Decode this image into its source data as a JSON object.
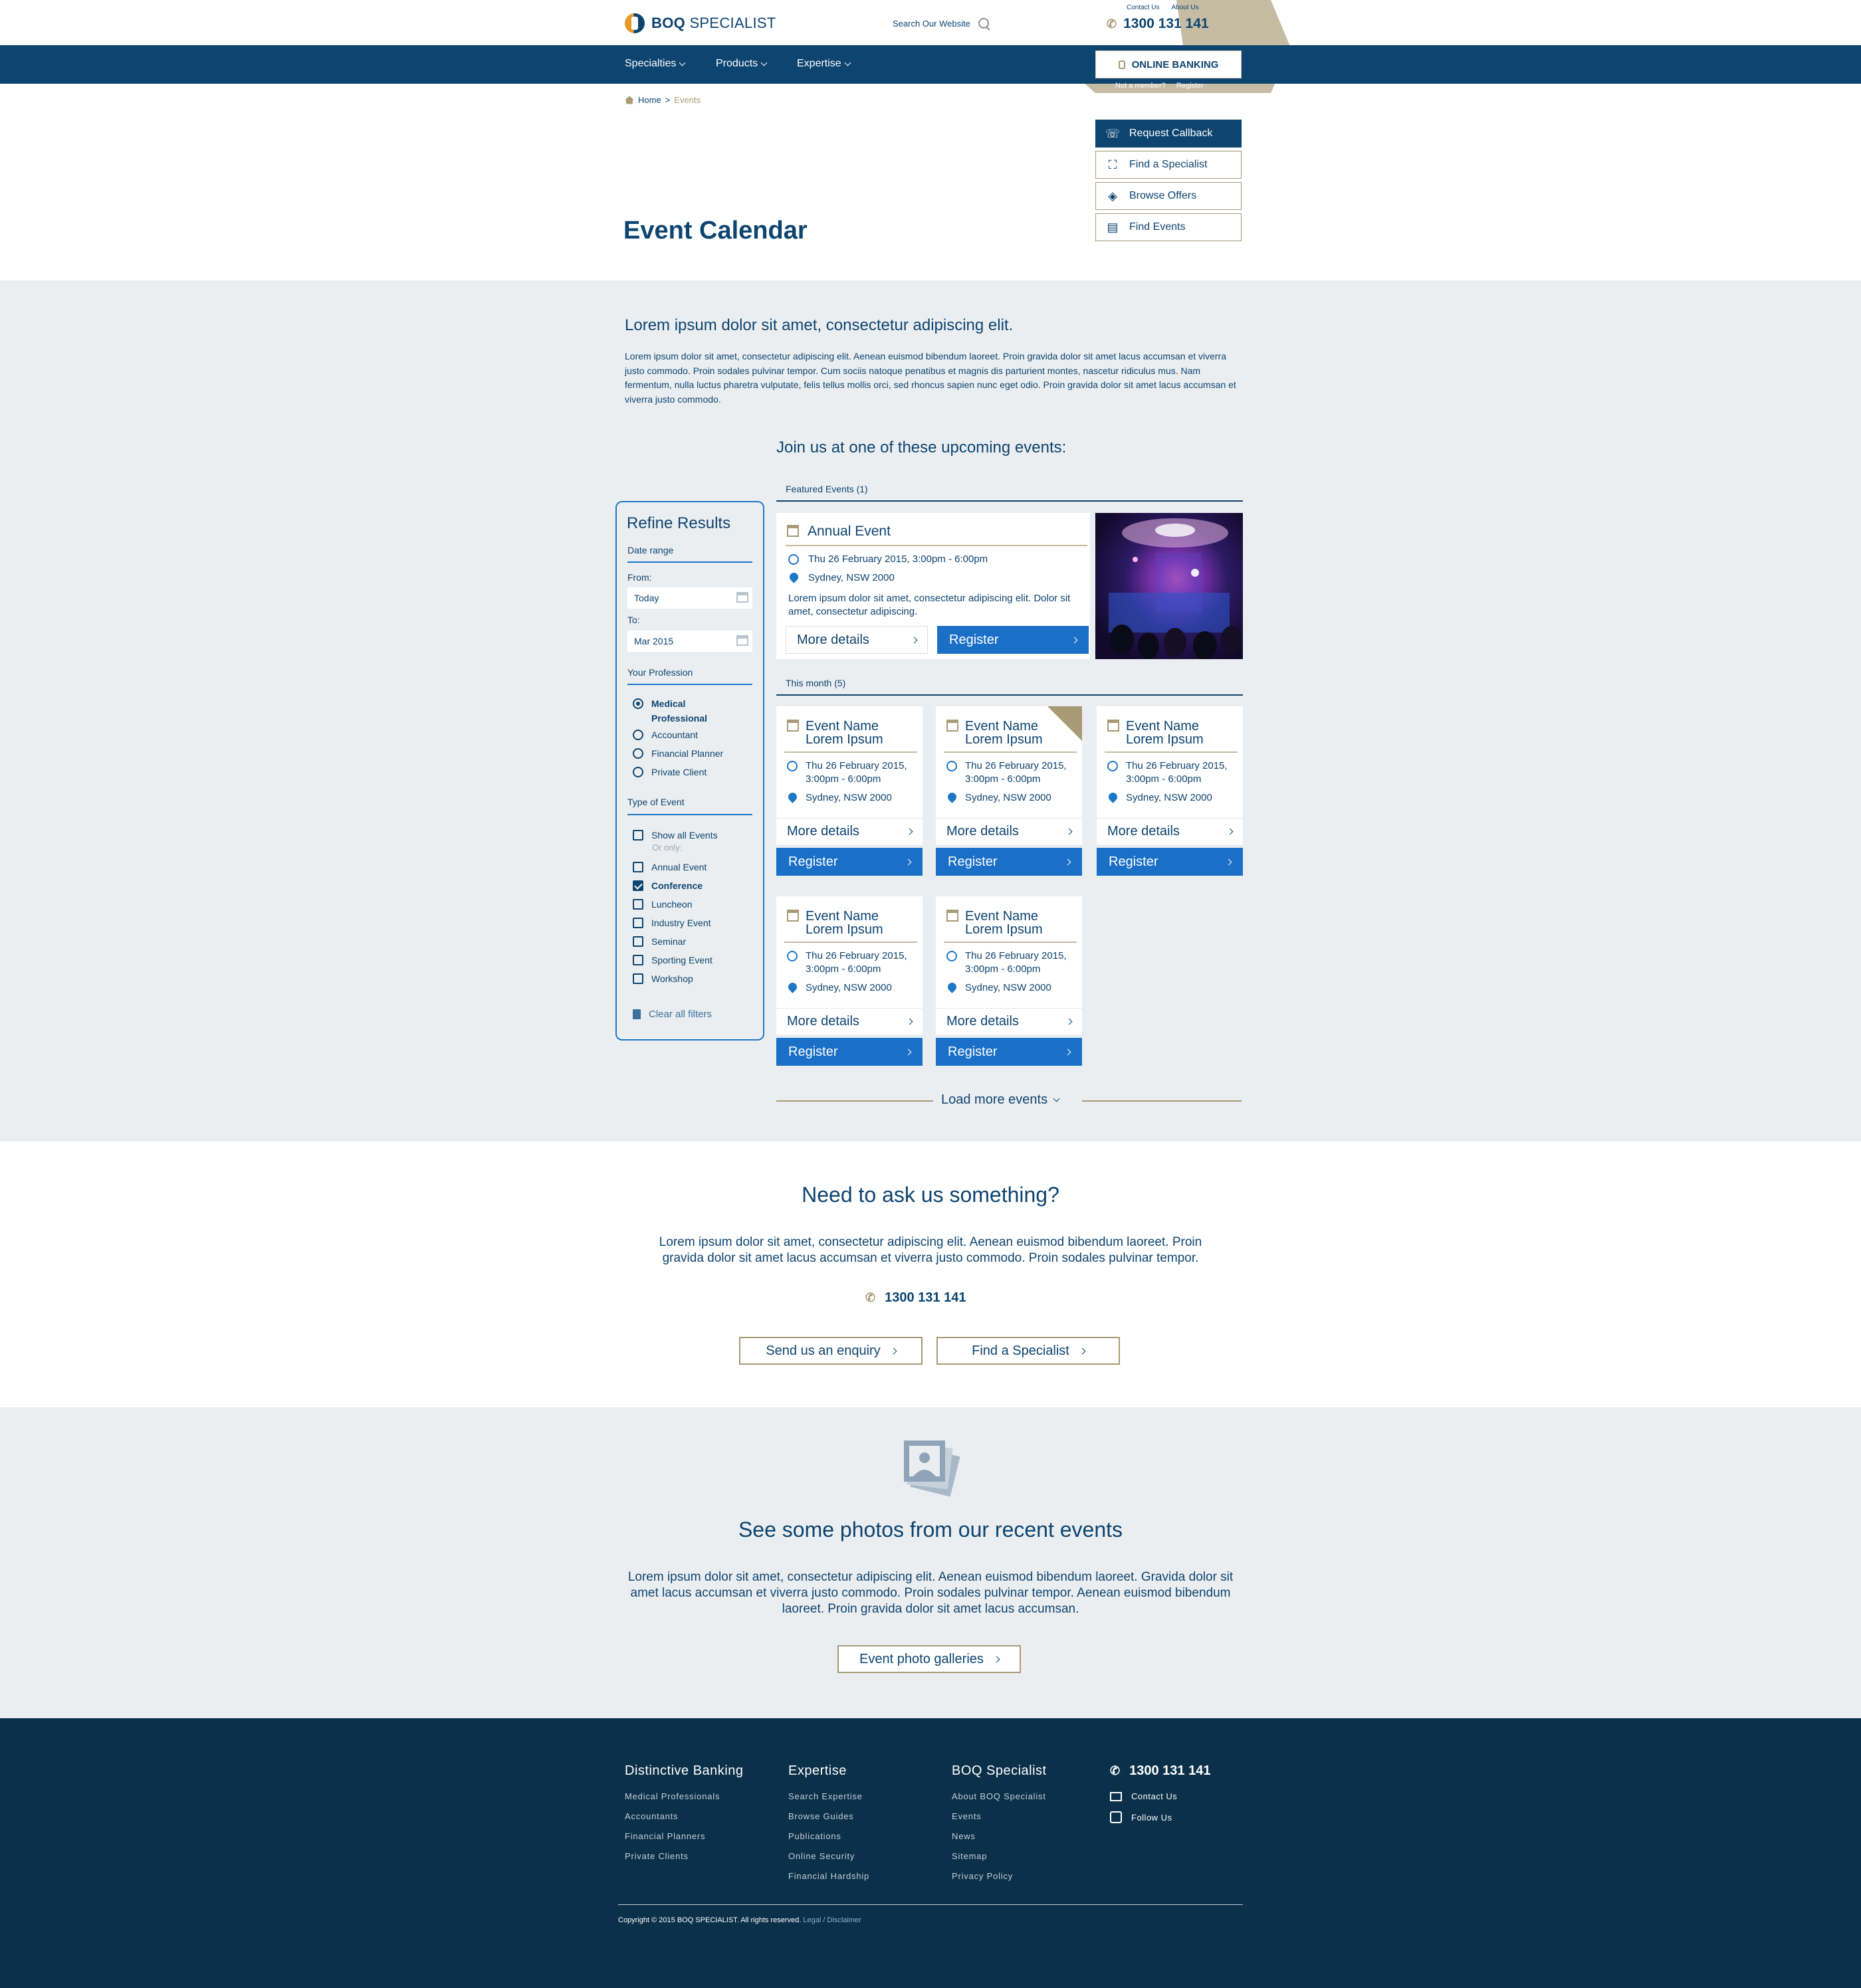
{
  "header": {
    "logo": {
      "bold": "BOQ",
      "rest": "SPECIALIST"
    },
    "search_label": "Search Our Website",
    "top_links": [
      "Contact Us",
      "About Us"
    ],
    "phone": "1300 131 141",
    "online_banking": "ONLINE BANKING",
    "not_member": "Not a member?",
    "register": "Register"
  },
  "nav": {
    "items": [
      "Specialties",
      "Products",
      "Expertise"
    ]
  },
  "breadcrumb": {
    "home": "Home",
    "sep": ">",
    "current": "Events"
  },
  "quick_links": [
    "Request Callback",
    "Find a Specialist",
    "Browse Offers",
    "Find Events"
  ],
  "page_title": "Event Calendar",
  "intro": {
    "heading": "Lorem ipsum dolor sit amet, consectetur adipiscing elit.",
    "body": "Lorem ipsum dolor sit amet, consectetur adipiscing elit. Aenean euismod bibendum laoreet. Proin gravida dolor sit amet lacus accumsan et viverra justo commodo. Proin sodales pulvinar tempor. Cum sociis natoque penatibus et magnis dis parturient montes, nascetur ridiculus mus. Nam fermentum, nulla luctus pharetra vulputate, felis tellus mollis orci, sed rhoncus sapien nunc eget odio. Proin gravida dolor sit amet lacus accumsan et viverra justo commodo."
  },
  "join_heading": "Join us at one of these upcoming events:",
  "refine": {
    "title": "Refine Results",
    "date_range": "Date range",
    "from_label": "From:",
    "from_value": "Today",
    "to_label": "To:",
    "to_value": "Mar 2015",
    "profession_label": "Your Profession",
    "professions": [
      "Medical Professional",
      "Accountant",
      "Financial Planner",
      "Private Client"
    ],
    "selected_profession": "Medical Professional",
    "type_label": "Type of Event",
    "show_all": "Show all Events",
    "or_only": "Or only:",
    "types": [
      "Annual Event",
      "Conference",
      "Luncheon",
      "Industry Event",
      "Seminar",
      "Sporting Event",
      "Workshop"
    ],
    "checked_types": [
      "Conference"
    ],
    "clear": "Clear all filters"
  },
  "featured": {
    "heading": "Featured Events (1)",
    "title": "Annual Event",
    "date": "Thu 26 February 2015, 3:00pm - 6:00pm",
    "location": "Sydney, NSW 2000",
    "desc": "Lorem ipsum dolor sit amet, consectetur adipiscing elit. Dolor sit amet, consectetur adipiscing.",
    "more": "More details",
    "register": "Register"
  },
  "month": {
    "heading": "This month (5)",
    "card": {
      "title_1": "Event Name",
      "title_2": "Lorem Ipsum",
      "date_1": "Thu 26 February 2015,",
      "date_2": "3:00pm - 6:00pm",
      "location": "Sydney, NSW 2000",
      "more": "More details",
      "register": "Register"
    }
  },
  "load_more": "Load more events",
  "ask": {
    "heading": "Need to ask us something?",
    "body": "Lorem ipsum dolor sit amet, consectetur adipiscing elit. Aenean euismod bibendum laoreet. Proin gravida dolor sit amet lacus accumsan et viverra justo commodo. Proin sodales pulvinar tempor.",
    "phone": "1300 131 141",
    "enquiry": "Send us an enquiry",
    "find": "Find a Specialist"
  },
  "photos": {
    "heading": "See some photos from our recent events",
    "body": "Lorem ipsum dolor sit amet, consectetur adipiscing elit. Aenean euismod bibendum laoreet. Gravida dolor sit amet lacus accumsan et viverra justo commodo. Proin sodales pulvinar tempor. Aenean euismod bibendum laoreet. Proin gravida dolor sit amet lacus accumsan.",
    "button": "Event photo galleries"
  },
  "footer": {
    "col1": {
      "title": "Distinctive Banking",
      "links": [
        "Medical Professionals",
        "Accountants",
        "Financial Planners",
        "Private Clients"
      ]
    },
    "col2": {
      "title": "Expertise",
      "links": [
        "Search Expertise",
        "Browse Guides",
        "Publications",
        "Online Security",
        "Financial Hardship"
      ]
    },
    "col3": {
      "title": "BOQ Specialist",
      "links": [
        "About BOQ Specialist",
        "Events",
        "News",
        "Sitemap",
        "Privacy Policy"
      ]
    },
    "phone": "1300 131 141",
    "contact": "Contact Us",
    "follow": "Follow Us",
    "copyright": "Copyright © 2015 BOQ SPECIALIST. All rights reserved.",
    "legal": "Legal / Disclaimer"
  },
  "colors": {
    "navy": "#0d4470",
    "gold": "#a79a74",
    "blue": "#1a6fc7",
    "footer": "#0b3049",
    "grey": "#ebeef1"
  }
}
